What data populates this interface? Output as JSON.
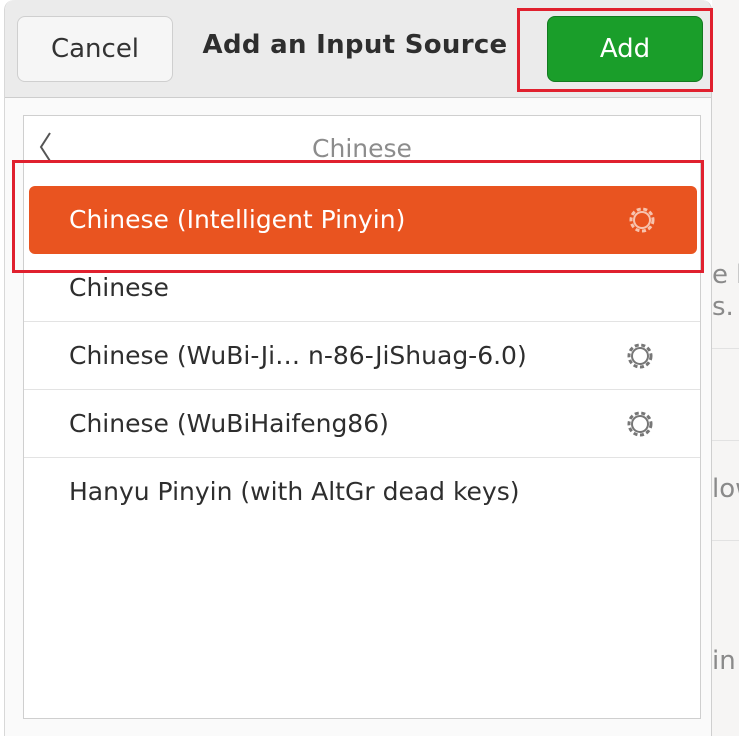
{
  "dialog": {
    "title": "Add an Input Source",
    "cancel_label": "Cancel",
    "add_label": "Add"
  },
  "list": {
    "breadcrumb": "Chinese",
    "items": [
      {
        "label": "Chinese (Intelligent Pinyin)",
        "settings_icon": "gear-icon",
        "selected": true
      },
      {
        "label": "Chinese",
        "settings_icon": null,
        "selected": false
      },
      {
        "label": "Chinese (WuBi-Ji… n-86-JiShuag-6.0)",
        "settings_icon": "gear-icon",
        "selected": false
      },
      {
        "label": "Chinese (WuBiHaifeng86)",
        "settings_icon": "gear-icon",
        "selected": false
      },
      {
        "label": "Hanyu Pinyin (with AltGr dead keys)",
        "settings_icon": null,
        "selected": false
      }
    ]
  },
  "background_window": {
    "fragments": [
      "e k",
      "s.",
      "low",
      "in"
    ]
  },
  "colors": {
    "accent": "#e95420",
    "add_button": "#1a9e2a",
    "highlight": "#e0202e"
  }
}
